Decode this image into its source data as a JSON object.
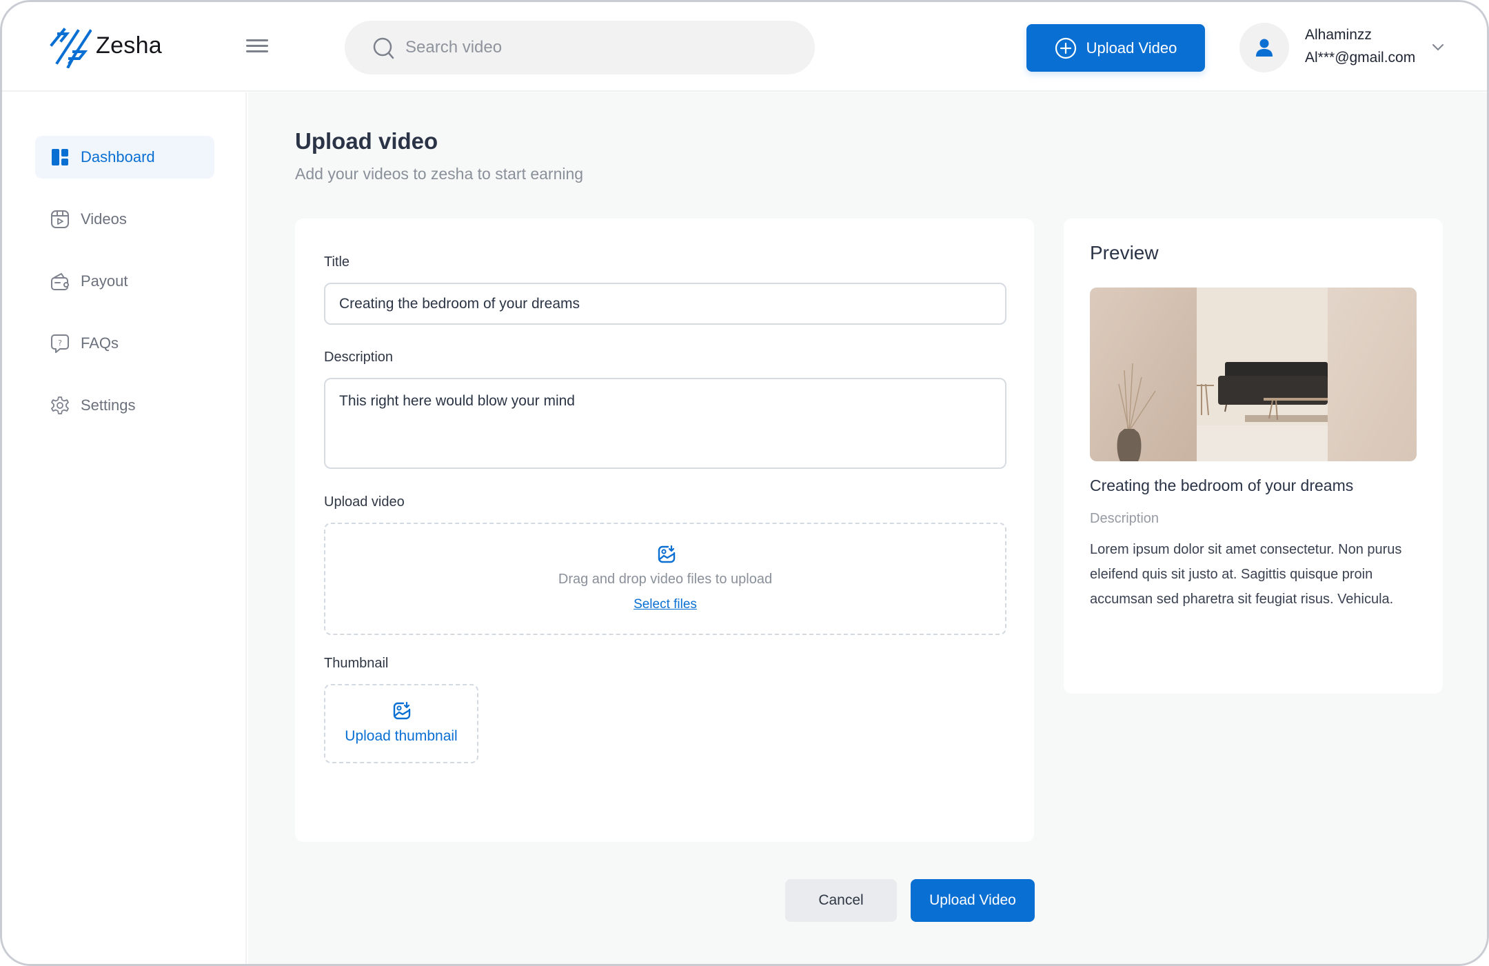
{
  "app": {
    "brand_name": "Zesha",
    "accent_color": "#0a6fd3"
  },
  "header": {
    "menu_icon": "hamburger-icon",
    "search": {
      "placeholder": "Search video",
      "value": "",
      "icon": "search-icon"
    },
    "upload_button": {
      "label": "Upload Video",
      "icon": "plus-circle-icon"
    },
    "user": {
      "name": "Alhaminzz",
      "email": "Al***@gmail.com",
      "avatar_icon": "user-icon",
      "menu_icon": "chevron-down-icon"
    }
  },
  "sidebar": {
    "items": [
      {
        "label": "Dashboard",
        "icon": "dashboard-icon",
        "active": true
      },
      {
        "label": "Videos",
        "icon": "video-icon",
        "active": false
      },
      {
        "label": "Payout",
        "icon": "wallet-icon",
        "active": false
      },
      {
        "label": "FAQs",
        "icon": "help-chat-icon",
        "active": false
      },
      {
        "label": "Settings",
        "icon": "gear-icon",
        "active": false
      }
    ]
  },
  "page": {
    "title": "Upload video",
    "subtitle": "Add your videos to zesha to start earning"
  },
  "form": {
    "title_label": "Title",
    "title_value": "Creating the bedroom of your dreams",
    "description_label": "Description",
    "description_value": "This right here would blow your mind",
    "upload_label": "Upload video",
    "dropzone_text": "Drag and drop video files to upload",
    "dropzone_link": "Select files",
    "thumbnail_label": "Thumbnail",
    "thumbnail_button": "Upload thumbnail"
  },
  "preview": {
    "heading": "Preview",
    "video_title": "Creating the bedroom of your dreams",
    "description_label": "Description",
    "description_text": "Lorem ipsum dolor sit amet consectetur. Non purus eleifend quis sit justo at. Sagittis quisque proin accumsan sed pharetra sit feugiat risus. Vehicula."
  },
  "actions": {
    "cancel_label": "Cancel",
    "submit_label": "Upload Video"
  }
}
